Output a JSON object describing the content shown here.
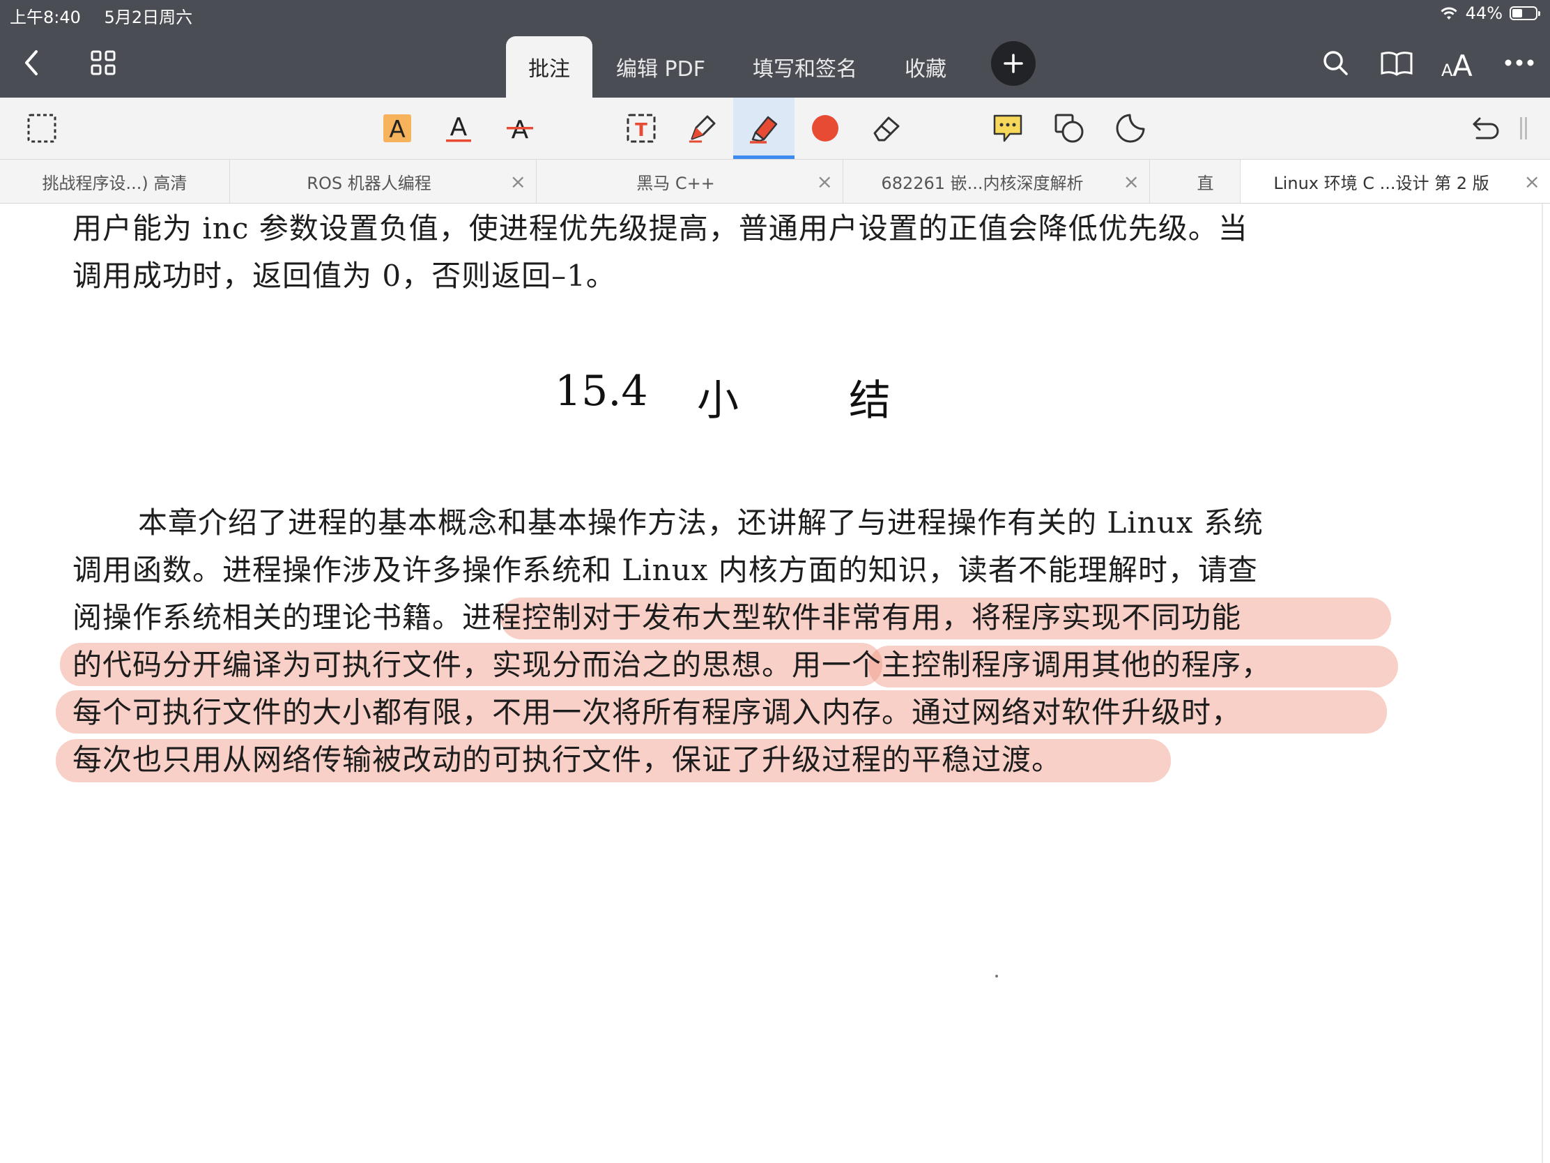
{
  "status_bar": {
    "time": "上午8:40",
    "date": "5月2日周六",
    "battery_percent": "44%",
    "battery_level": 0.44
  },
  "nav": {
    "back_icon": "chevron-left-icon",
    "grid_icon": "grid-icon",
    "tabs": [
      {
        "label": "批注",
        "active": true
      },
      {
        "label": "编辑 PDF",
        "active": false
      },
      {
        "label": "填写和签名",
        "active": false
      },
      {
        "label": "收藏",
        "active": false
      }
    ],
    "add_icon": "plus-icon",
    "right_icons": [
      "search-icon",
      "book-icon",
      "text-size-icon",
      "more-icon"
    ]
  },
  "toolbar": {
    "tools": [
      "select-icon",
      "highlight-text-icon",
      "underline-text-icon",
      "strikethrough-text-icon",
      "text-box-icon",
      "pen-icon",
      "highlighter-icon",
      "color-dot-icon",
      "eraser-icon",
      "comment-icon",
      "shapes-icon",
      "sticker-icon",
      "undo-icon"
    ],
    "active_tool": "highlighter-icon",
    "accent_color": "#e84b33",
    "highlight_color": "#f0a090",
    "active_indicator_color": "#3d8af0"
  },
  "doc_tabs": [
    {
      "label": "挑战程序设...) 高清",
      "closable": false,
      "active": false
    },
    {
      "label": "ROS 机器人编程",
      "closable": true,
      "active": false
    },
    {
      "label": "黑马 C++",
      "closable": true,
      "active": false
    },
    {
      "label": "682261 嵌...内核深度解析",
      "closable": true,
      "active": false
    },
    {
      "label": "直",
      "closable": false,
      "active": false
    },
    {
      "label": "Linux 环境 C ...设计 第 2 版",
      "closable": true,
      "active": true
    }
  ],
  "document": {
    "top_paragraph": [
      "用户能为 inc 参数设置负值，使进程优先级提高，普通用户设置的正值会降低优先级。当",
      "调用成功时，返回值为 0，否则返回–1。"
    ],
    "section_number": "15.4",
    "section_title_1": "小",
    "section_title_2": "结",
    "summary_lines": [
      "本章介绍了进程的基本概念和基本操作方法，还讲解了与进程操作有关的 Linux 系统",
      "调用函数。进程操作涉及许多操作系统和 Linux 内核方面的知识，读者不能理解时，请查",
      "阅操作系统相关的理论书籍。进程控制对于发布大型软件非常有用，将程序实现不同功能",
      "的代码分开编译为可执行文件，实现分而治之的思想。用一个主控制程序调用其他的程序，",
      "每个可执行文件的大小都有限，不用一次将所有程序调入内存。通过网络对软件升级时，",
      "每次也只用从网络传输被改动的可执行文件，保证了升级过程的平稳过渡。"
    ]
  }
}
